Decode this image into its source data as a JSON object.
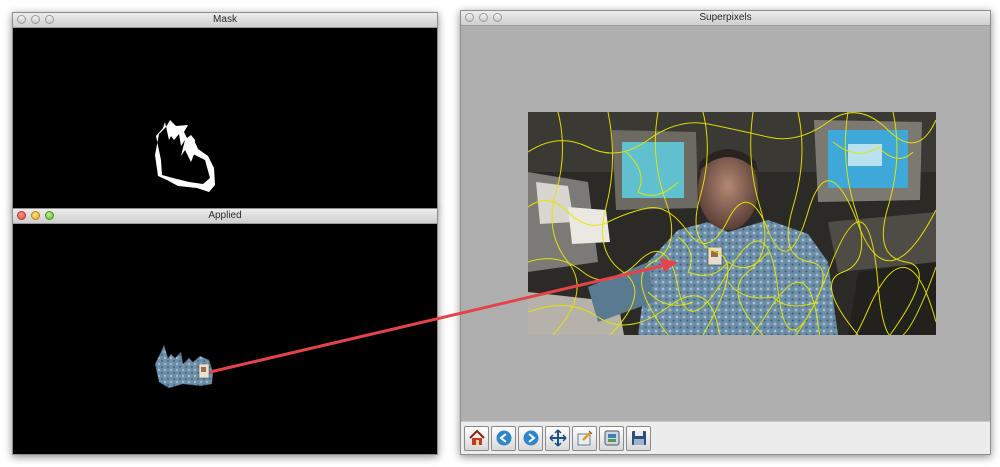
{
  "windows": {
    "mask": {
      "title": "Mask"
    },
    "applied": {
      "title": "Applied"
    },
    "superpixels": {
      "title": "Superpixels"
    }
  },
  "toolbar": {
    "buttons": [
      {
        "icon": "home-icon"
      },
      {
        "icon": "back-arrow-icon"
      },
      {
        "icon": "forward-arrow-icon"
      },
      {
        "icon": "pan-move-icon"
      },
      {
        "icon": "zoom-rect-icon"
      },
      {
        "icon": "configure-subplots-icon"
      },
      {
        "icon": "save-floppy-icon"
      }
    ]
  },
  "colors": {
    "window_bg": "#000000",
    "superpixel_outline": "#e6e600",
    "arrow": "#e3444a",
    "canvas_bg": "#afafaf"
  }
}
